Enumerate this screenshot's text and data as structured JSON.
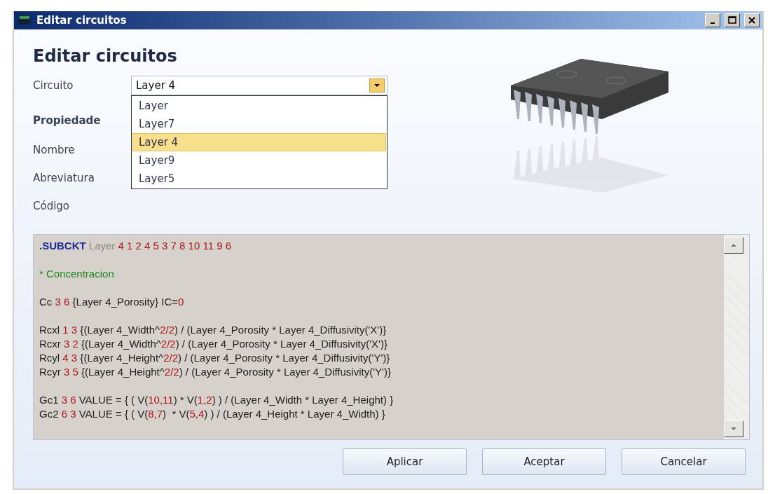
{
  "window": {
    "title": "Editar circuitos"
  },
  "heading": "Editar circuitos",
  "circuit": {
    "label": "Circuito",
    "value": "Layer 4",
    "expanded": true,
    "options": [
      {
        "label": "Layer",
        "selected": false
      },
      {
        "label": "Layer7",
        "selected": false
      },
      {
        "label": "Layer 4",
        "selected": true
      },
      {
        "label": "Layer9",
        "selected": false
      },
      {
        "label": "Layer5",
        "selected": false
      }
    ]
  },
  "properties": {
    "title": "Propiedade",
    "fields": [
      {
        "label": "Nombre"
      },
      {
        "label": "Abreviatura"
      }
    ]
  },
  "code": {
    "label": "Código",
    "blocks": [
      [
        [
          {
            "kind": "keyword",
            "text": ".SUBCKT"
          },
          {
            "kind": "name",
            "text": " Layer "
          },
          {
            "kind": "number",
            "text": "4 1 2 4 5 3 7 8 10 11 9 6"
          }
        ]
      ],
      [
        [
          {
            "kind": "comment",
            "text": "* Concentracion"
          }
        ]
      ],
      [
        [
          {
            "kind": "text",
            "text": "Cc "
          },
          {
            "kind": "number",
            "text": "3 6"
          },
          {
            "kind": "text",
            "text": " {Layer 4_Porosity} IC="
          },
          {
            "kind": "number",
            "text": "0"
          }
        ]
      ],
      [
        [
          {
            "kind": "text",
            "text": "Rcxl "
          },
          {
            "kind": "number",
            "text": "1 3"
          },
          {
            "kind": "text",
            "text": " {(Layer 4_Width^"
          },
          {
            "kind": "number",
            "text": "2/2"
          },
          {
            "kind": "text",
            "text": ") / (Layer 4_Porosity * Layer 4_Diffusivity('X')}"
          }
        ],
        [
          {
            "kind": "text",
            "text": "Rcxr "
          },
          {
            "kind": "number",
            "text": "3 2"
          },
          {
            "kind": "text",
            "text": " {(Layer 4_Width^"
          },
          {
            "kind": "number",
            "text": "2/2"
          },
          {
            "kind": "text",
            "text": ") / (Layer 4_Porosity * Layer 4_Diffusivity('X')}"
          }
        ],
        [
          {
            "kind": "text",
            "text": "Rcyl "
          },
          {
            "kind": "number",
            "text": "4 3"
          },
          {
            "kind": "text",
            "text": " {(Layer 4_Height^"
          },
          {
            "kind": "number",
            "text": "2/2"
          },
          {
            "kind": "text",
            "text": ") / (Layer 4_Porosity * Layer 4_Diffusivity('Y')}"
          }
        ],
        [
          {
            "kind": "text",
            "text": "Rcyr "
          },
          {
            "kind": "number",
            "text": "3 5"
          },
          {
            "kind": "text",
            "text": " {(Layer 4_Height^"
          },
          {
            "kind": "number",
            "text": "2/2"
          },
          {
            "kind": "text",
            "text": ") / (Layer 4_Porosity * Layer 4_Diffusivity('Y')}"
          }
        ]
      ],
      [
        [
          {
            "kind": "text",
            "text": "Gc1 "
          },
          {
            "kind": "number",
            "text": "3 6"
          },
          {
            "kind": "text",
            "text": " VALUE = { ( V("
          },
          {
            "kind": "number",
            "text": "10,11"
          },
          {
            "kind": "text",
            "text": ") * V("
          },
          {
            "kind": "number",
            "text": "1,2"
          },
          {
            "kind": "text",
            "text": ") ) / (Layer 4_Width * Layer 4_Height) }"
          }
        ],
        [
          {
            "kind": "text",
            "text": "Gc2 "
          },
          {
            "kind": "number",
            "text": "6 3"
          },
          {
            "kind": "text",
            "text": " VALUE = { ( V("
          },
          {
            "kind": "number",
            "text": "8,7"
          },
          {
            "kind": "text",
            "text": ")  * V("
          },
          {
            "kind": "number",
            "text": "5,4"
          },
          {
            "kind": "text",
            "text": ") ) / (Layer 4_Height * Layer 4_Width) }"
          }
        ]
      ]
    ]
  },
  "buttons": [
    "Aplicar",
    "Aceptar",
    "Cancelar"
  ]
}
